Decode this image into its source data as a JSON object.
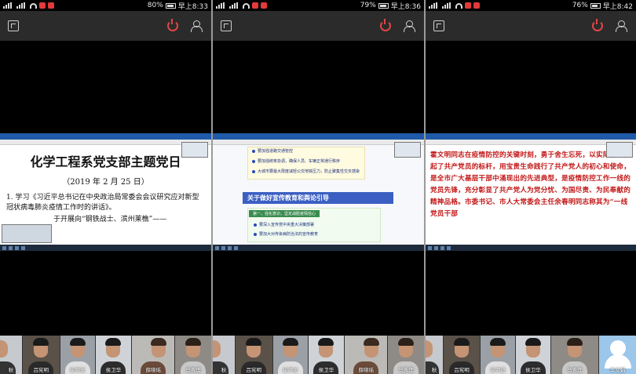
{
  "panels": [
    {
      "status": {
        "battery": "80%",
        "time": "早上8:33"
      },
      "doc": {
        "title": "化学工程系党支部主题党日",
        "date": "（2019 年 2 月 25 日）",
        "para1": "1. 学习《习近平总书记在中央政治局常委会会议研究应对新型冠状病毒肺炎疫情工作时的讲话》。",
        "para2": "于开展向“钢铁战士、滨州莱樵”——"
      },
      "participants": [
        "秋",
        "吕宪明",
        "崔洪波",
        "侯卫华",
        "薛晓瑶",
        "马秀莲"
      ]
    },
    {
      "status": {
        "battery": "79%",
        "time": "早上8:36"
      },
      "ppt": {
        "b1": "要加强道路交通管控",
        "b2": "要加强统筹协调，确保人员、车辆正常通行秩序",
        "b3": "大城市要最大限度减轻公交地铁压力，防止聚集性交叉感染",
        "heading": "关于做好宣传教育和舆论引导",
        "subheading": "第一，强化意识，坚定战胜疫情信心",
        "c1": "要深入宣传党中央重大决策部署",
        "c2": "要加大对传染病防治法的宣传教育"
      },
      "participants": [
        "秋",
        "吕宪明",
        "崔洪波",
        "侯卫华",
        "薛晓瑶",
        "马秀莲"
      ]
    },
    {
      "status": {
        "battery": "76%",
        "time": "早上8:42"
      },
      "text": "霍文明同志在疫情防控的关键时刻，勇于舍生忘死，以实际行动树起了共产党员的标杆，用宝贵生命践行了共产党人的初心和使命，是全市广大基层干部中涌现出的先进典型，是疫情防控工作一线的党员先锋，充分彰显了共产党人为党分忧、为国尽责、为民奉献的精神品格。市委书记、市人大常委会主任余春明同志称其为“一线党员干部",
      "participants": [
        "秋",
        "吕宪明",
        "崔洪波",
        "侯卫华",
        "马秀莲",
        "李文娟"
      ]
    }
  ],
  "colors": {
    "power": "#e04646",
    "toolbar": "#2b2b2b",
    "accent": "#3b5fc2",
    "red_text": "#c21616"
  }
}
